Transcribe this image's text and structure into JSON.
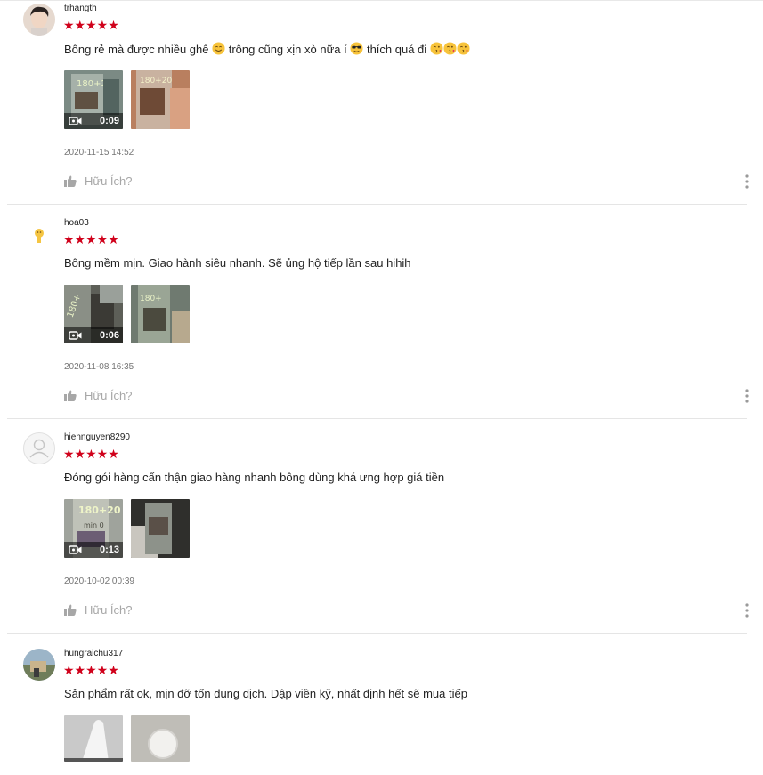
{
  "reviews": [
    {
      "username": "trhangth",
      "stars": "★★★★★",
      "comment_parts": [
        "Bông rẻ mà được nhiều ghê ",
        " trông cũng xịn xò nữa í ",
        " thích quá đi "
      ],
      "media": [
        {
          "duration": "0:09"
        },
        {
          "duration": ""
        }
      ],
      "date": "2020-11-15 14:52",
      "helpful_label": "Hữu Ích?"
    },
    {
      "username": "hoa03",
      "stars": "★★★★★",
      "comment": "Bông mềm mịn. Giao hành siêu nhanh.  Sẽ ủng hộ tiếp lần sau hihih",
      "media": [
        {
          "duration": "0:06"
        },
        {
          "duration": ""
        }
      ],
      "date": "2020-11-08 16:35",
      "helpful_label": "Hữu Ích?"
    },
    {
      "username": "hiennguyen8290",
      "stars": "★★★★★",
      "comment": "Đóng gói hàng cẩn thận giao hàng nhanh bông dùng khá ưng hợp giá tiền",
      "media": [
        {
          "duration": "0:13"
        },
        {
          "duration": ""
        }
      ],
      "date": "2020-10-02 00:39",
      "helpful_label": "Hữu Ích?"
    },
    {
      "username": "hungraichu317",
      "stars": "★★★★★",
      "comment": "Sản phẩm rất ok, mịn  đỡ tốn dung dịch. Dập viền kỹ, nhất định hết sẽ mua tiếp",
      "media": [
        {
          "duration": ""
        },
        {
          "duration": ""
        }
      ]
    }
  ],
  "colors": {
    "star": "#d0011b",
    "meta": "#757575",
    "helpful": "#a7a7a7"
  }
}
